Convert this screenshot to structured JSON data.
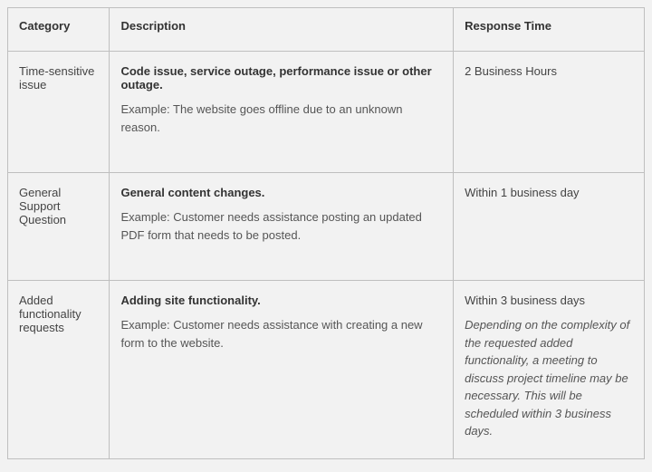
{
  "headers": {
    "category": "Category",
    "description": "Description",
    "response": "Response Time"
  },
  "rows": [
    {
      "category": "Time-sensitive issue",
      "desc_title": "Code issue, service outage, performance issue or other outage.",
      "desc_example": "Example: The website goes offline due to an unknown reason.",
      "response_main": "2 Business Hours",
      "response_note": ""
    },
    {
      "category": "General Support Question",
      "desc_title": "General content changes.",
      "desc_example": "Example: Customer needs assistance posting an updated PDF form that needs to be posted.",
      "response_main": "Within 1 business day",
      "response_note": ""
    },
    {
      "category": "Added functionality requests",
      "desc_title": "Adding site functionality.",
      "desc_example": "Example: Customer needs assistance with creating a new form to the website.",
      "response_main": "Within 3 business days",
      "response_note": "Depending on the complexity of the requested added functionality, a meeting to discuss project timeline may be necessary. This will be scheduled within 3 business days."
    }
  ]
}
